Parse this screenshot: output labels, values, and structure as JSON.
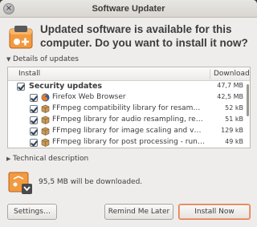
{
  "window": {
    "title": "Software Updater"
  },
  "header": {
    "message": "Updated software is available for this computer. Do you want to install it now?"
  },
  "details_expander": {
    "label": "Details of updates",
    "expanded": true
  },
  "tree": {
    "columns": {
      "install": "Install",
      "download": "Download"
    },
    "groups": [
      {
        "label": "Security updates",
        "size": "47,7 MB",
        "checked": true,
        "items": [
          {
            "label": "Firefox Web Browser",
            "size": "42,5 MB",
            "checked": true,
            "icon": "firefox-icon"
          },
          {
            "label": "FFmpeg compatibility library for resampling",
            "size": "52 kB",
            "checked": true,
            "icon": "package-icon"
          },
          {
            "label": "FFmpeg library for audio resampling, rematrixing",
            "size": "51 kB",
            "checked": true,
            "icon": "package-icon"
          },
          {
            "label": "FFmpeg library for image scaling and various conversions",
            "size": "129 kB",
            "checked": true,
            "icon": "package-icon"
          },
          {
            "label": "FFmpeg library for post processing - runtime files",
            "size": "49 kB",
            "checked": true,
            "icon": "package-icon"
          }
        ]
      }
    ]
  },
  "technical_expander": {
    "label": "Technical description",
    "expanded": false
  },
  "download_notice": {
    "text": "95,5 MB will be downloaded."
  },
  "buttons": {
    "settings": "Settings…",
    "remind": "Remind Me Later",
    "install": "Install Now"
  },
  "colors": {
    "accent": "#e07a4f",
    "icon_orange": "#f29a3f",
    "window_bg": "#efedec"
  }
}
